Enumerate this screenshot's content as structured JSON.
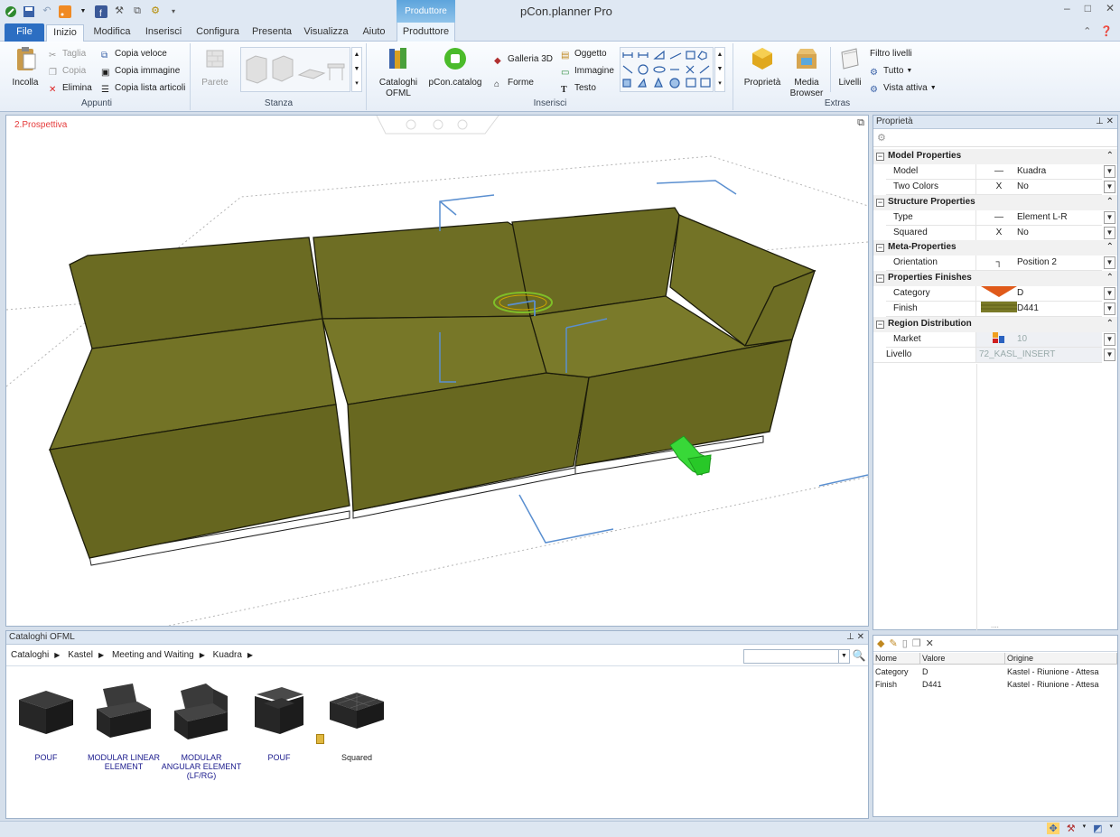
{
  "window": {
    "title": "pCon.planner Pro",
    "context_group": "Produttore",
    "controls": [
      "–",
      "□",
      "✕"
    ]
  },
  "tabs": [
    {
      "label": "File"
    },
    {
      "label": "Inizio"
    },
    {
      "label": "Modifica"
    },
    {
      "label": "Inserisci"
    },
    {
      "label": "Configura"
    },
    {
      "label": "Presenta"
    },
    {
      "label": "Visualizza"
    },
    {
      "label": "Aiuto"
    },
    {
      "label": "Produttore"
    }
  ],
  "ribbon": {
    "appunti": {
      "label": "Appunti",
      "incolla": "Incolla",
      "taglia": "Taglia",
      "copia": "Copia",
      "elimina": "Elimina",
      "copia_veloce": "Copia veloce",
      "copia_immagine": "Copia immagine",
      "copia_lista": "Copia lista articoli"
    },
    "stanza": {
      "label": "Stanza",
      "parete": "Parete"
    },
    "inserisci": {
      "label": "Inserisci",
      "cataloghi": "Cataloghi OFML",
      "pcon_catalog": "pCon.catalog",
      "galleria": "Galleria 3D",
      "forme": "Forme",
      "oggetto": "Oggetto",
      "immagine": "Immagine",
      "testo": "Testo"
    },
    "extras": {
      "label": "Extras",
      "proprieta": "Proprietà",
      "media": "Media Browser",
      "livelli": "Livelli",
      "filtro": "Filtro livelli",
      "tutto": "Tutto",
      "vista": "Vista attiva"
    }
  },
  "viewport": {
    "label": "2.Prospettiva"
  },
  "properties": {
    "title": "Proprietà",
    "rows": [
      {
        "type": "section",
        "label": "Model Properties"
      },
      {
        "type": "item",
        "label": "Model",
        "icon": "—",
        "value": "Kuadra"
      },
      {
        "type": "item",
        "label": "Two Colors",
        "icon": "X",
        "value": "No"
      },
      {
        "type": "section",
        "label": "Structure Properties"
      },
      {
        "type": "item",
        "label": "Type",
        "icon": "—",
        "value": "Element L-R"
      },
      {
        "type": "item",
        "label": "Squared",
        "icon": "X",
        "value": "No"
      },
      {
        "type": "section",
        "label": "Meta-Properties"
      },
      {
        "type": "item",
        "label": "Orientation",
        "icon": "┐",
        "value": "Position 2"
      },
      {
        "type": "section",
        "label": "Properties Finishes"
      },
      {
        "type": "item",
        "label": "Category",
        "icon": "swatch-orange",
        "value": "D"
      },
      {
        "type": "item",
        "label": "Finish",
        "icon": "swatch-green",
        "value": "D441"
      },
      {
        "type": "section",
        "label": "Region Distribution"
      },
      {
        "type": "item",
        "label": "Market",
        "icon": "market-icon",
        "value": "10",
        "disabled": true
      },
      {
        "type": "root",
        "label": "Livello",
        "value": "72_KASL_INSERT",
        "disabled": true
      }
    ]
  },
  "attributes": {
    "columns": [
      "Nome",
      "Valore",
      "Origine"
    ],
    "rows": [
      {
        "nome": "Category",
        "valore": "D",
        "origine": "Kastel - Riunione - Attesa"
      },
      {
        "nome": "Finish",
        "valore": "D441",
        "origine": "Kastel - Riunione - Attesa"
      }
    ]
  },
  "catalog": {
    "title": "Cataloghi OFML",
    "breadcrumb": [
      "Cataloghi",
      "Kastel",
      "Meeting and Waiting",
      "Kuadra"
    ],
    "items": [
      {
        "name": "POUF",
        "shape": "cube"
      },
      {
        "name": "MODULAR LINEAR ELEMENT",
        "shape": "linear"
      },
      {
        "name": "MODULAR ANGULAR ELEMENT (LF/RG)",
        "shape": "angular"
      },
      {
        "name": "POUF",
        "shape": "armchair"
      },
      {
        "name": "Squared",
        "shape": "squared"
      }
    ]
  }
}
